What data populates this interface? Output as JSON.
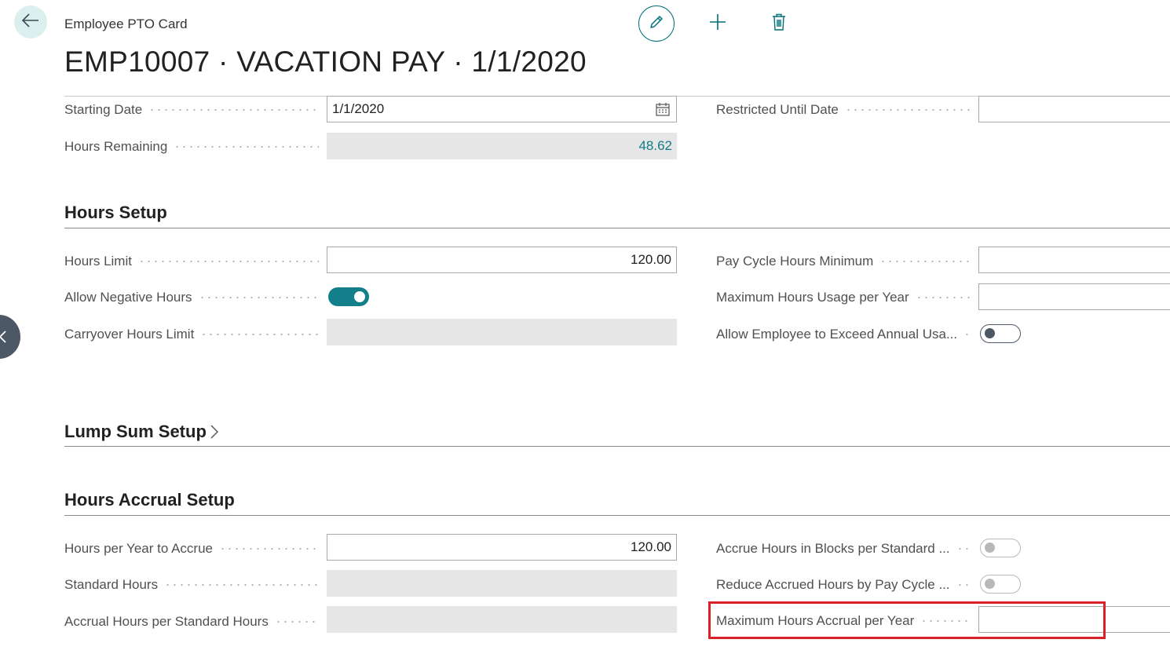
{
  "header": {
    "subtitle": "Employee PTO Card",
    "title": "EMP10007 · VACATION PAY · 1/1/2020"
  },
  "icons": {
    "back": "arrow-left-icon",
    "edit": "pencil-icon",
    "add": "plus-icon",
    "delete": "trash-icon",
    "calendar": "calendar-icon",
    "chevron": "chevron-right-icon",
    "side": "chevron-left-icon"
  },
  "colors": {
    "accent": "#00707a",
    "toggle_on": "#137f8a",
    "highlight": "#d9212c",
    "readonly_bg": "#e6e6e6"
  },
  "general": {
    "starting_date": {
      "label": "Starting Date",
      "value": "1/1/2020"
    },
    "hours_remaining": {
      "label": "Hours Remaining",
      "value": "48.62"
    },
    "restricted_until": {
      "label": "Restricted Until Date",
      "value": ""
    }
  },
  "hours_setup": {
    "title": "Hours Setup",
    "hours_limit": {
      "label": "Hours Limit",
      "value": "120.00"
    },
    "allow_negative": {
      "label": "Allow Negative Hours",
      "on": true
    },
    "carryover_limit": {
      "label": "Carryover Hours Limit",
      "value": ""
    },
    "pay_cycle_min": {
      "label": "Pay Cycle Hours Minimum",
      "value": ""
    },
    "max_usage": {
      "label": "Maximum Hours Usage per Year",
      "value": ""
    },
    "allow_exceed": {
      "label": "Allow Employee to Exceed Annual Usa...",
      "on": false
    }
  },
  "lump_sum": {
    "title": "Lump Sum Setup"
  },
  "accrual_setup": {
    "title": "Hours Accrual Setup",
    "per_year": {
      "label": "Hours per Year to Accrue",
      "value": "120.00"
    },
    "standard_hours": {
      "label": "Standard Hours",
      "value": ""
    },
    "accrual_per_standard": {
      "label": "Accrual Hours per Standard Hours",
      "value": ""
    },
    "blocks": {
      "label": "Accrue Hours in Blocks per Standard ...",
      "on": false
    },
    "reduce": {
      "label": "Reduce Accrued Hours by Pay Cycle ...",
      "on": false
    },
    "max_accrual": {
      "label": "Maximum Hours Accrual per Year",
      "value": ""
    }
  }
}
